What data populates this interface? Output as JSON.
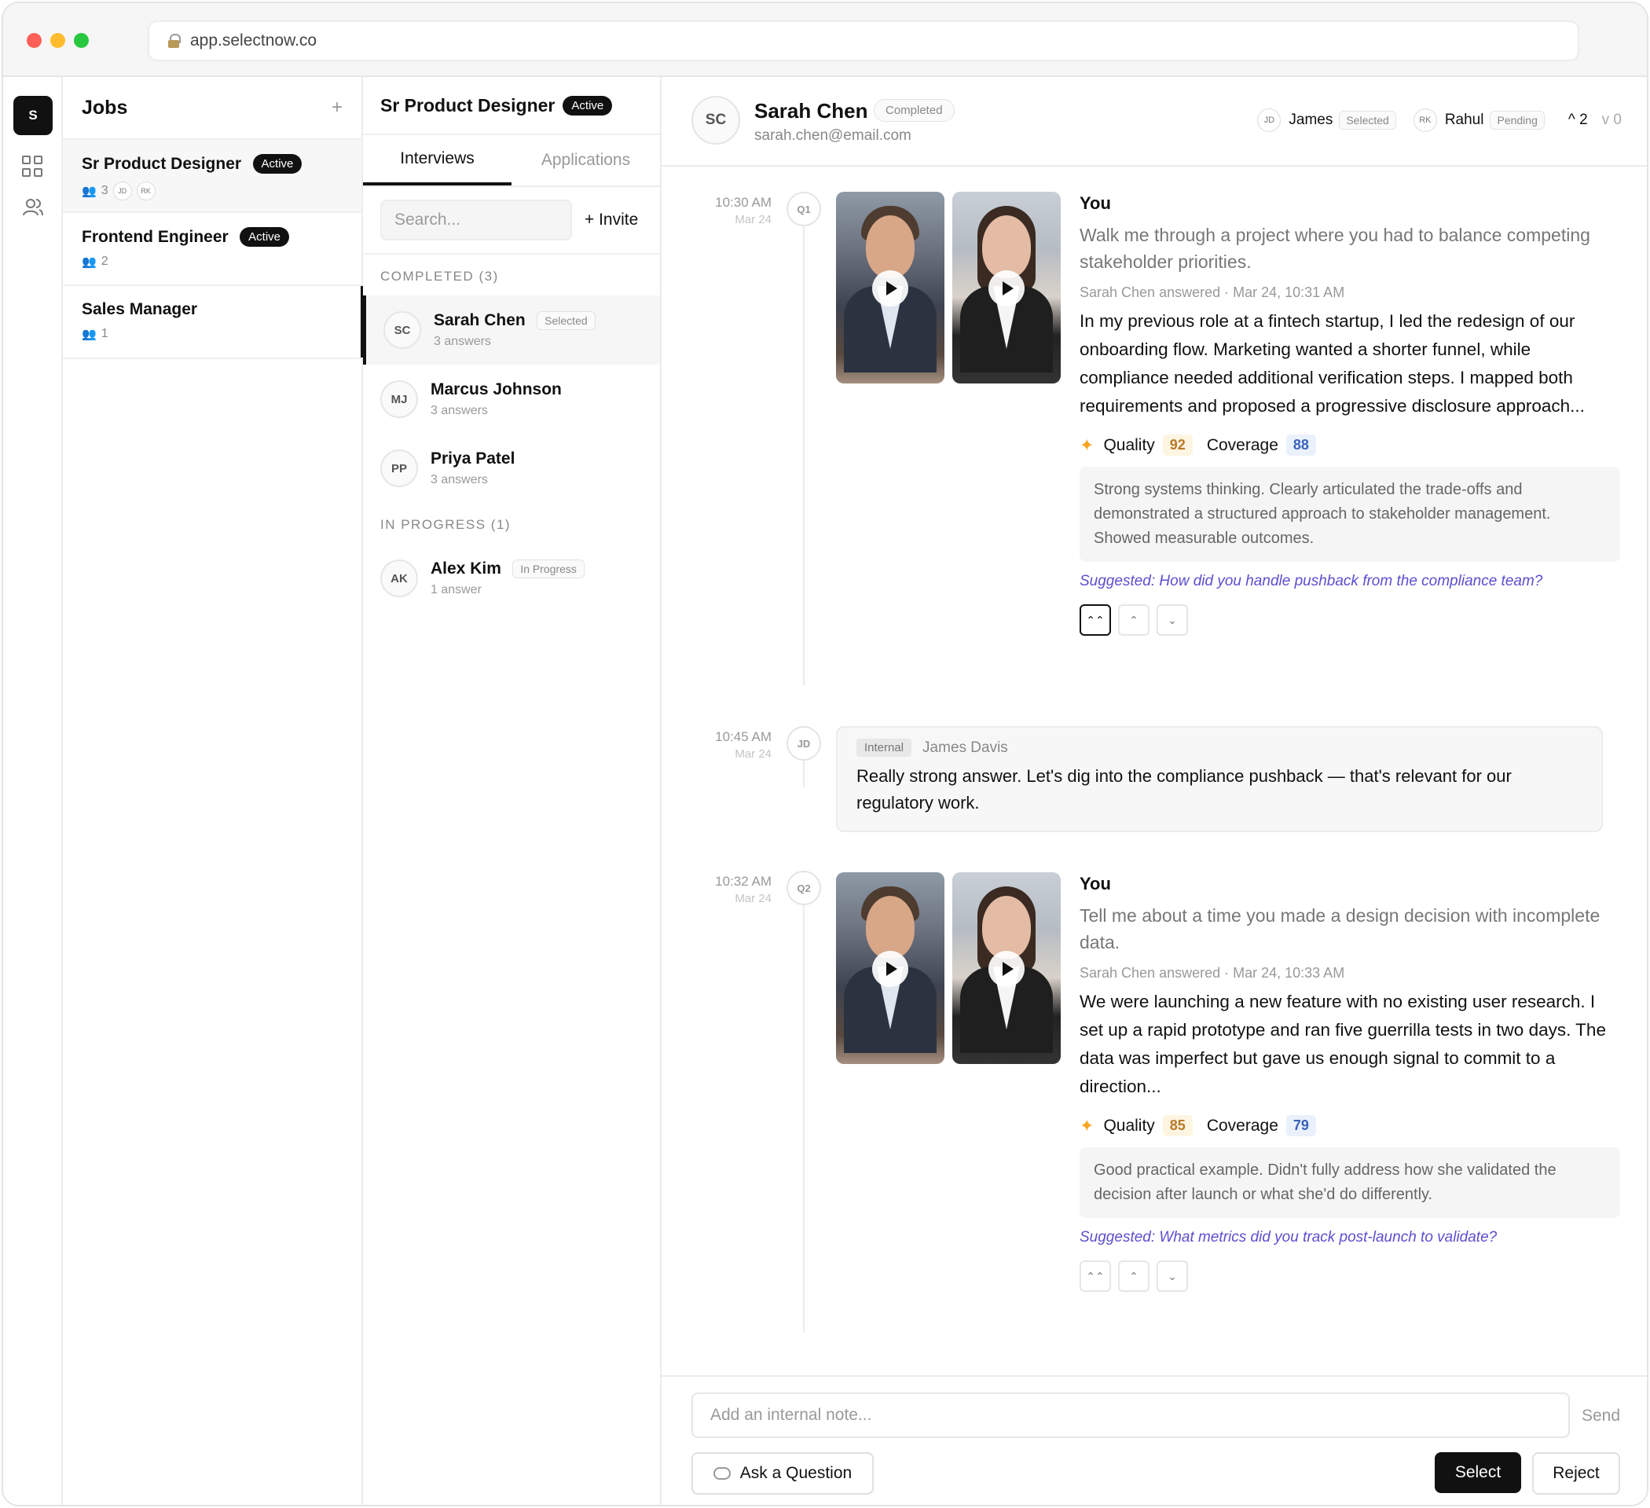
{
  "browser": {
    "url": "app.selectnow.co"
  },
  "rail": {
    "logo": "S",
    "icons": [
      "grid-icon",
      "users-icon"
    ]
  },
  "jobs": {
    "title": "Jobs",
    "add": "+",
    "items": [
      {
        "name": "Sr Product Designer",
        "status": "Active",
        "count": "3",
        "reviewers": [
          "JD",
          "RK"
        ]
      },
      {
        "name": "Frontend Engineer",
        "status": "Active",
        "count": "2"
      },
      {
        "name": "Sales Manager",
        "count": "1"
      }
    ]
  },
  "candidates": {
    "job_title": "Sr Product Designer",
    "job_status": "Active",
    "tabs": [
      "Interviews",
      "Applications"
    ],
    "search_placeholder": "Search...",
    "invite": "+ Invite",
    "completed_label": "COMPLETED (3)",
    "in_progress_label": "IN PROGRESS (1)",
    "list": [
      {
        "initials": "SC",
        "name": "Sarah Chen",
        "badge": "Selected",
        "answers": "3 answers"
      },
      {
        "initials": "MJ",
        "name": "Marcus Johnson",
        "answers": "3 answers"
      },
      {
        "initials": "PP",
        "name": "Priya Patel",
        "answers": "3 answers"
      },
      {
        "initials": "AK",
        "name": "Alex Kim",
        "badge": "In Progress",
        "answers": "1 answer"
      }
    ]
  },
  "detail": {
    "initials": "SC",
    "name": "Sarah Chen",
    "status": "Completed",
    "email": "sarah.chen@email.com",
    "reviewers": [
      {
        "initials": "JD",
        "name": "James",
        "status": "Selected"
      },
      {
        "initials": "RK",
        "name": "Rahul",
        "status": "Pending"
      }
    ],
    "votes_up": "^ 2",
    "votes_down": "v 0",
    "q1": {
      "time": "10:30 AM",
      "date": "Mar 24",
      "tag": "Q1",
      "author": "You",
      "question": "Walk me through a project where you had to balance competing stakeholder priorities.",
      "answered": "Sarah Chen answered · Mar 24, 10:31 AM",
      "answer": "In my previous role at a fintech startup, I led the redesign of our onboarding flow. Marketing wanted a shorter funnel, while compliance needed additional verification steps. I mapped both requirements and proposed a progressive disclosure approach...",
      "quality_label": "Quality",
      "quality": "92",
      "coverage_label": "Coverage",
      "coverage": "88",
      "feedback": "Strong systems thinking. Clearly articulated the trade-offs and demonstrated a structured approach to stakeholder management. Showed measurable outcomes.",
      "suggested": "Suggested: How did you handle pushback from the compliance team?"
    },
    "note": {
      "time": "10:45 AM",
      "date": "Mar 24",
      "tag": "JD",
      "pill": "Internal",
      "author": "James Davis",
      "text": "Really strong answer. Let's dig into the compliance pushback — that's relevant for our regulatory work."
    },
    "q2": {
      "time": "10:32 AM",
      "date": "Mar 24",
      "tag": "Q2",
      "author": "You",
      "question": "Tell me about a time you made a design decision with incomplete data.",
      "answered": "Sarah Chen answered · Mar 24, 10:33 AM",
      "answer": "We were launching a new feature with no existing user research. I set up a rapid prototype and ran five guerrilla tests in two days. The data was imperfect but gave us enough signal to commit to a direction...",
      "quality_label": "Quality",
      "quality": "85",
      "coverage_label": "Coverage",
      "coverage": "79",
      "feedback": "Good practical example. Didn't fully address how she validated the decision after launch or what she'd do differently.",
      "suggested": "Suggested: What metrics did you track post-launch to validate?"
    },
    "footer": {
      "note_placeholder": "Add an internal note...",
      "send": "Send",
      "ask": "Ask a Question",
      "select": "Select",
      "reject": "Reject"
    }
  },
  "colors": {
    "accent": "#111111",
    "suggested": "#5a4fcf",
    "quality": "#b9782a",
    "coverage": "#3a63b8",
    "spark": "#f5a623"
  }
}
